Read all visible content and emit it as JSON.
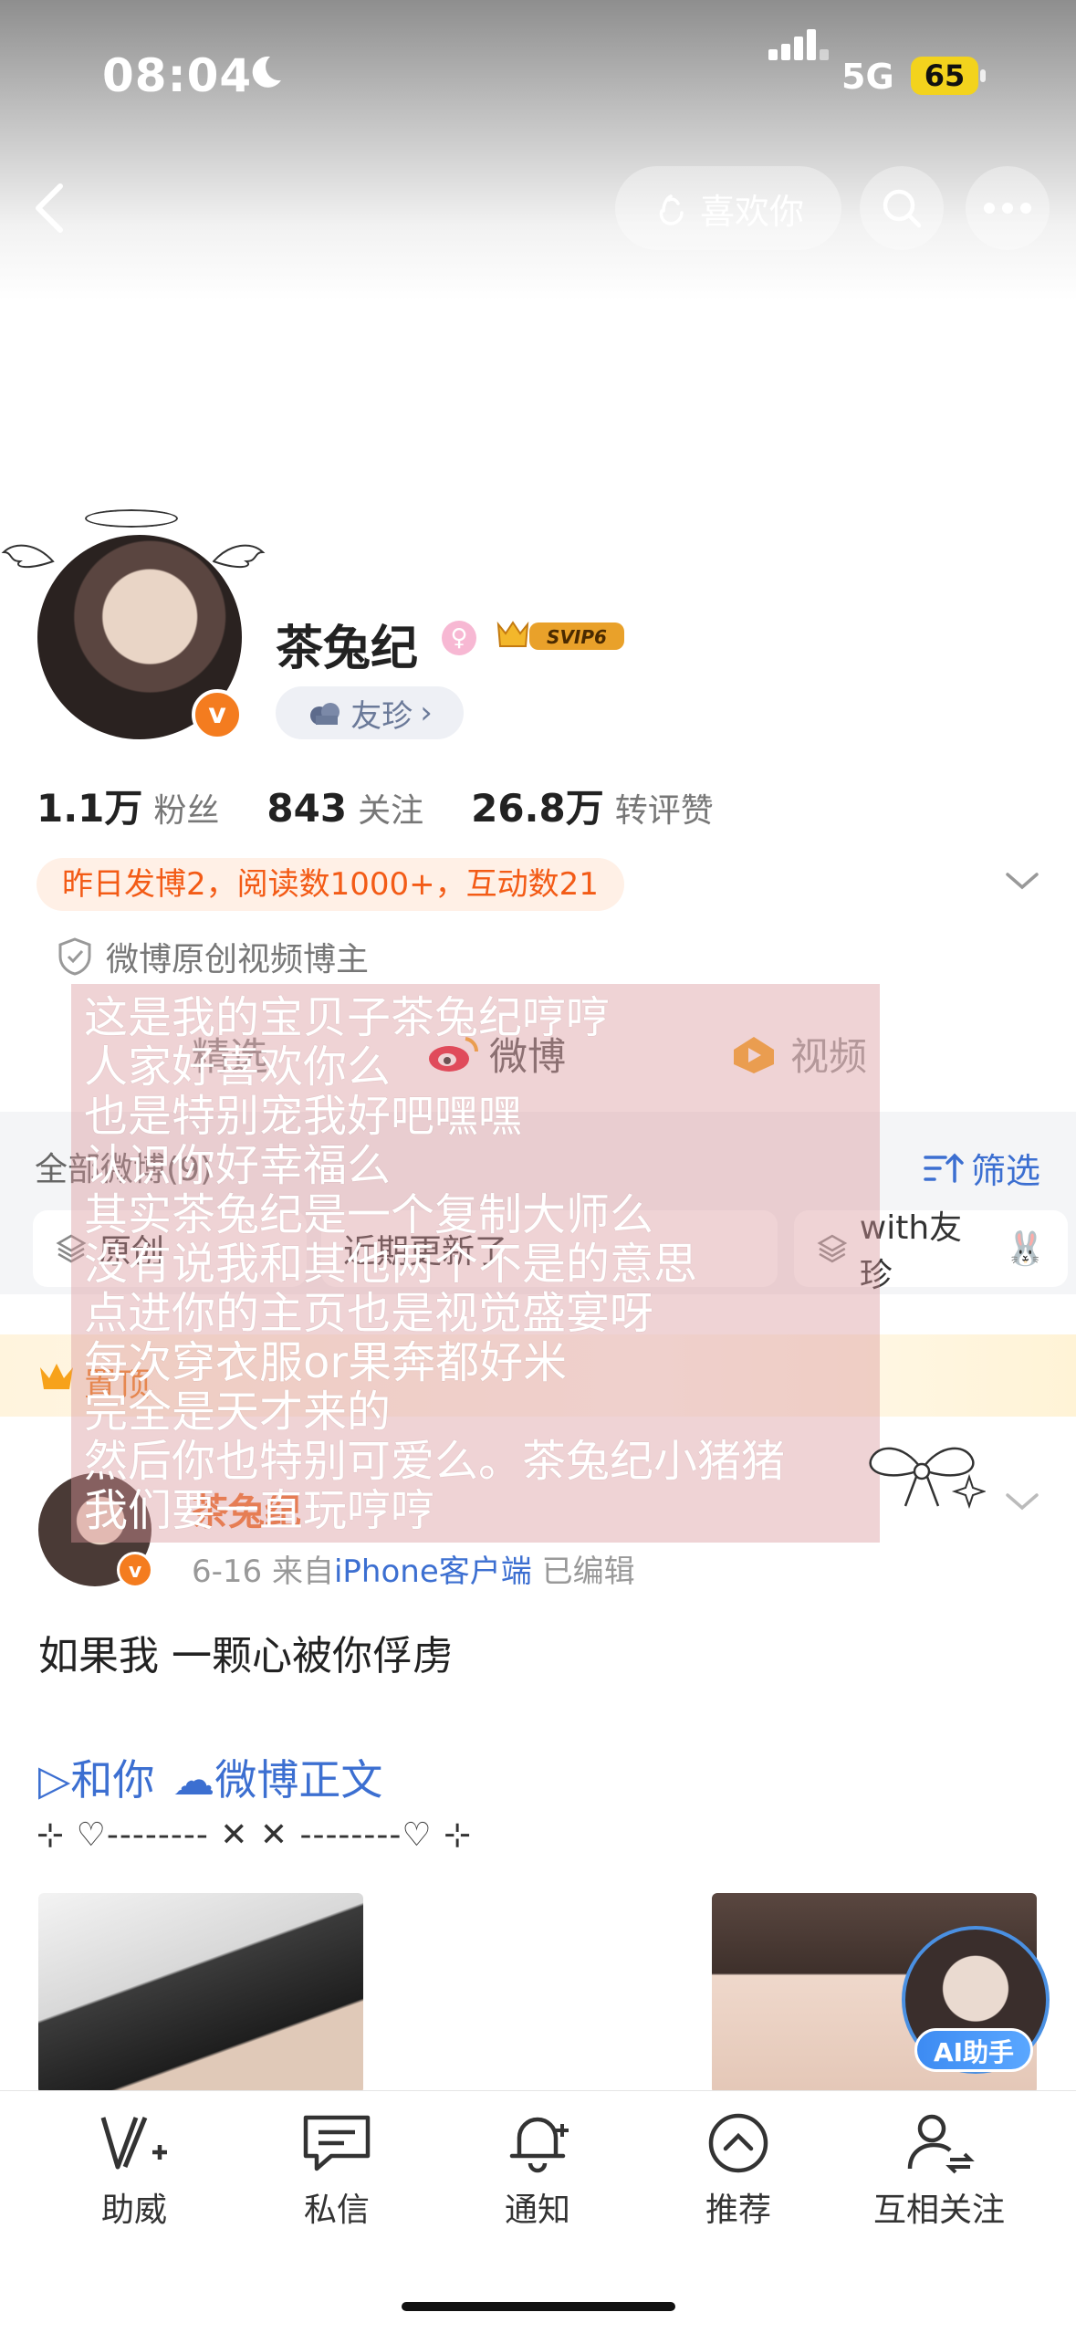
{
  "status_bar": {
    "time": "08:04",
    "network": "5G",
    "battery": "65"
  },
  "header": {
    "like_label": "喜欢你"
  },
  "profile": {
    "name": "茶兔纪",
    "svip_label": "SVIP6",
    "friend_tag": "友珍",
    "stats": [
      {
        "num": "1.1万",
        "label": "粉丝"
      },
      {
        "num": "843",
        "label": "关注"
      },
      {
        "num": "26.8万",
        "label": "转评赞"
      }
    ],
    "yesterday": "昨日发博2，阅读数1000+，互动数21",
    "verified": "微博原创视频博主"
  },
  "tabs": {
    "home": "精选",
    "weibo": "微博",
    "video": "视频"
  },
  "filter_row": {
    "all_label": "全部微博(9)",
    "filter_label": "筛选",
    "chip1": "原创",
    "chip2": "近期更新了",
    "chip3": "with友珍"
  },
  "vip_banner": {
    "label": "置顶"
  },
  "post": {
    "author": "茶兔纪",
    "date": "6-16",
    "source_prefix": "来自",
    "source": "iPhone客户端",
    "edited": "已编辑",
    "text": "如果我 一颗心被你俘虏",
    "link1": "▷和你",
    "link2": "微博正文",
    "decoration": "⊹ ♡-------- ✕ ✕ --------♡ ⊹",
    "ai_label": "AI助手"
  },
  "overlay_lines": [
    "这是我的宝贝子茶兔纪哼哼",
    "人家好喜欢你么",
    "也是特别宠我好吧嘿嘿",
    "认识你好幸福么",
    "其实茶兔纪是一个复制大师么",
    "没有说我和其他两个不是的意思",
    "点进你的主页也是视觉盛宴呀",
    "每次穿衣服or果奔都好米",
    "完全是天才来的",
    "然后你也特别可爱么。茶兔纪小猪猪",
    "我们要一直玩哼哼"
  ],
  "bottom_bar": [
    {
      "label": "助威"
    },
    {
      "label": "私信"
    },
    {
      "label": "通知"
    },
    {
      "label": "推荐"
    },
    {
      "label": "互相关注"
    }
  ],
  "colors": {
    "accent_blue": "#3c6fd1",
    "orange": "#f35b16",
    "vip_orange": "#f47c1f",
    "overlay_pink": "#d8969b"
  }
}
